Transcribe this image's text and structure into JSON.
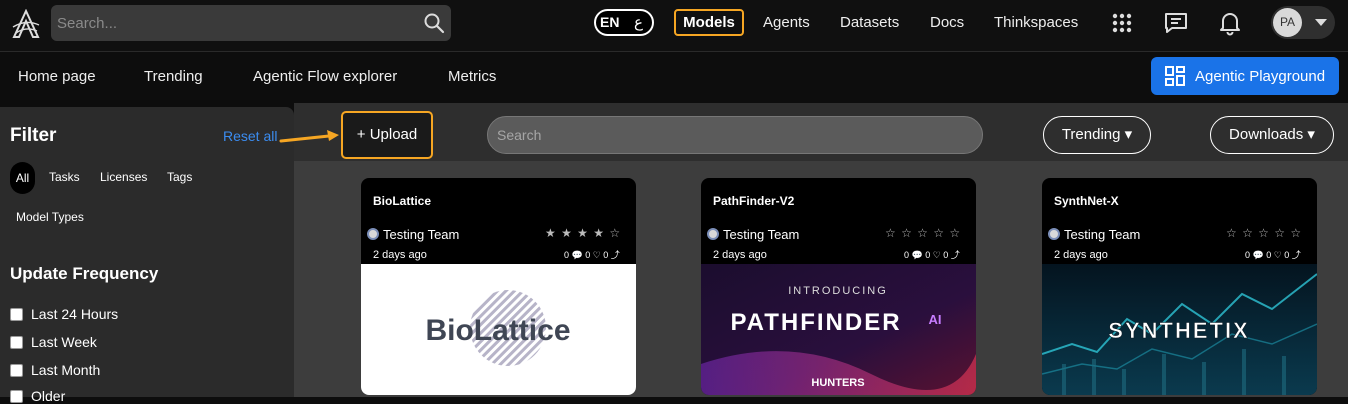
{
  "header": {
    "search_placeholder": "Search...",
    "lang_en": "EN",
    "lang_ar": "ع",
    "nav": {
      "models": "Models",
      "agents": "Agents",
      "datasets": "Datasets",
      "docs": "Docs",
      "thinkspaces": "Thinkspaces"
    },
    "avatar_initials": "PA"
  },
  "subnav": {
    "items": [
      "Home page",
      "Trending",
      "Agentic Flow explorer",
      "Metrics"
    ],
    "playground_label": "Agentic Playground"
  },
  "sidebar": {
    "title": "Filter",
    "reset_label": "Reset all",
    "tabs": [
      "All",
      "Tasks",
      "Licenses",
      "Tags",
      "Model Types"
    ],
    "update_frequency_title": "Update Frequency",
    "frequency_options": [
      "Last 24 Hours",
      "Last Week",
      "Last Month",
      "Older"
    ]
  },
  "toolbar": {
    "upload_label": "+ Upload",
    "search_placeholder": "Search",
    "trending_label": "Trending ▾",
    "downloads_label": "Downloads ▾"
  },
  "cards": [
    {
      "title": "BioLattice",
      "org": "Testing Team",
      "stars": "★ ★ ★ ★ ☆",
      "date": "2 days ago",
      "stats": "0 💬 0 ♡ 0 ⤴",
      "image_text": "BioLattice"
    },
    {
      "title": "PathFinder-V2",
      "org": "Testing Team",
      "stars": "☆ ☆ ☆ ☆ ☆",
      "date": "2 days ago",
      "stats": "0 💬 0 ♡ 0 ⤴",
      "image_text_top": "INTRODUCING",
      "image_text": "PATHFINDER",
      "image_text_ai": "AI",
      "image_footer": "HUNTERS"
    },
    {
      "title": "SynthNet-X",
      "org": "Testing Team",
      "stars": "☆ ☆ ☆ ☆ ☆",
      "date": "2 days ago",
      "stats": "0 💬 0 ♡ 0 ⤴",
      "image_text": "SYNTHETIX"
    }
  ],
  "colors": {
    "accent_orange": "#f6a623",
    "primary_blue": "#1a73e8",
    "link_blue": "#3b8cf0"
  }
}
